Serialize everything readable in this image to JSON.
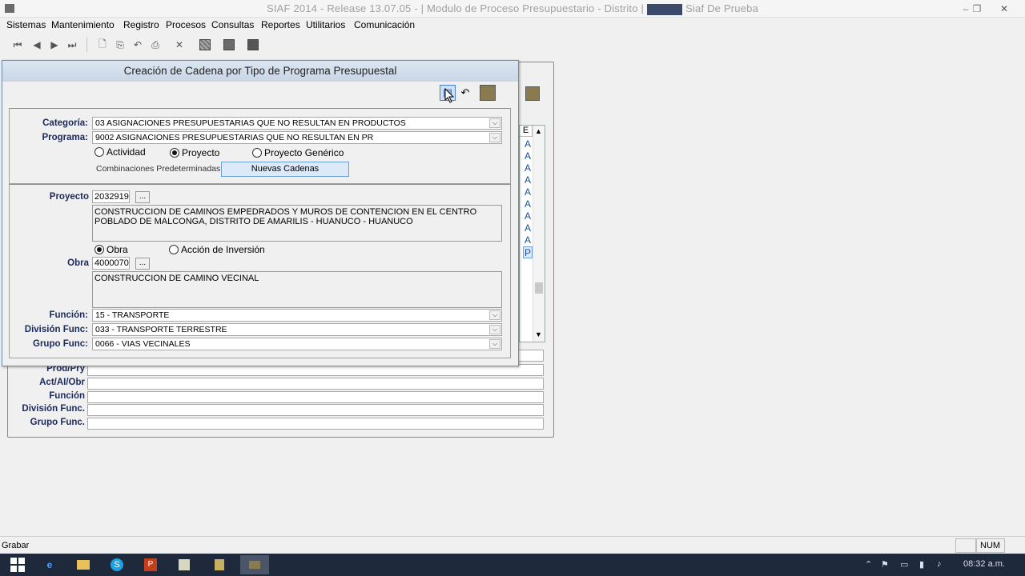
{
  "window": {
    "title_left": "SIAF 2014 - Release 13.07.05 - | Modulo de Proceso Presupuestario - Distrito |",
    "title_right": "Siaf De Prueba",
    "min": "–",
    "max": "❐",
    "close": "✕"
  },
  "menu": [
    "Sistemas",
    "Mantenimiento",
    "Registro",
    "Procesos",
    "Consultas",
    "Reportes",
    "Utilitarios",
    "Comunicación"
  ],
  "toolbar": {
    "first": "⏮",
    "prev": "◀",
    "next": "▶",
    "last": "⏭",
    "new": "🗋",
    "copy": "⎘",
    "undo": "↶",
    "print": "⎙",
    "delete": "✕"
  },
  "background_form": {
    "list_header": "E",
    "list_cells": [
      "A",
      "A",
      "A",
      "A",
      "A",
      "A",
      "A",
      "A",
      "A",
      "P"
    ],
    "rows": [
      "Prod/Pry",
      "Act/AI/Obr",
      "Función",
      "División Func.",
      "Grupo Func."
    ]
  },
  "dialog": {
    "title": "Creación de Cadena por Tipo de Programa Presupuestal",
    "categoria_label": "Categoría:",
    "categoria_value": "03 ASIGNACIONES PRESUPUESTARIAS QUE NO RESULTAN EN PRODUCTOS",
    "programa_label": "Programa:",
    "programa_value": "9002 ASIGNACIONES PRESUPUESTARIAS QUE NO RESULTAN EN PR",
    "radio_actividad": "Actividad",
    "radio_proyecto": "Proyecto",
    "radio_proyecto_generico": "Proyecto Genérico",
    "combinaciones_label": "Combinaciones Predeterminadas",
    "nuevas_cadenas": "Nuevas Cadenas",
    "proyecto_label": "Proyecto",
    "proyecto_code": "2032919",
    "proyecto_desc": "CONSTRUCCION DE CAMINOS EMPEDRADOS Y MUROS DE CONTENCION EN EL CENTRO POBLADO DE MALCONGA, DISTRITO DE AMARILIS - HUANUCO - HUANUCO",
    "radio_obra": "Obra",
    "radio_accion": "Acción de Inversión",
    "obra_label": "Obra",
    "obra_code": "4000070",
    "obra_desc": "CONSTRUCCION DE CAMINO VECINAL",
    "funcion_label": "Función:",
    "funcion_value": "15 - TRANSPORTE",
    "division_label": "División Func:",
    "division_value": "033 - TRANSPORTE TERRESTRE",
    "grupo_label": "Grupo Func:",
    "grupo_value": "0066 - VIAS VECINALES",
    "dots": "..."
  },
  "status": {
    "text": "Grabar",
    "num": "NUM"
  },
  "taskbar": {
    "time": "08:32 a.m."
  }
}
